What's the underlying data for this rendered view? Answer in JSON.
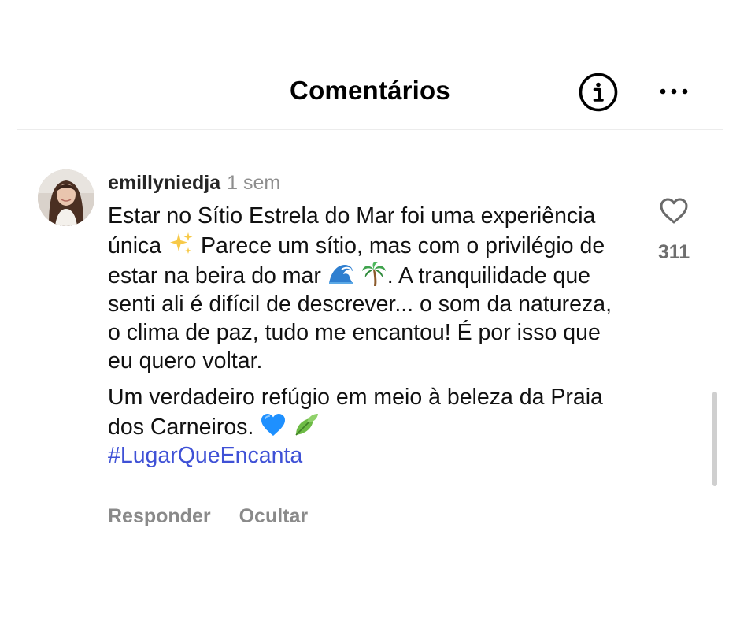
{
  "header": {
    "title": "Comentários",
    "info_icon": "info-circle-icon",
    "more_icon": "more-horizontal-icon"
  },
  "comment": {
    "username": "emillyniedja",
    "time": "1 sem",
    "text_part1": "Estar no Sítio Estrela do Mar foi uma experiência única",
    "emoji_1": "sparkles-emoji",
    "text_part2": "Parece um sítio, mas com o privilégio de estar na beira do mar",
    "emoji_2": "wave-emoji",
    "emoji_3": "palm-tree-emoji",
    "text_part3": ". A tranquilidade que senti ali é difícil de descrever... o som da natureza, o clima de paz, tudo me encantou! É por isso que eu quero voltar.",
    "paragraph2": "Um verdadeiro refúgio em meio à beleza da Praia dos Carneiros.",
    "emoji_4": "blue-heart-emoji",
    "emoji_5": "leaves-emoji",
    "hashtag": "#LugarQueEncanta",
    "reply_label": "Responder",
    "hide_label": "Ocultar",
    "like_count": "311"
  },
  "colors": {
    "hashtag": "#3f51d6",
    "secondary_text": "#8e8e8e",
    "blue_heart": "#1e90ff"
  }
}
